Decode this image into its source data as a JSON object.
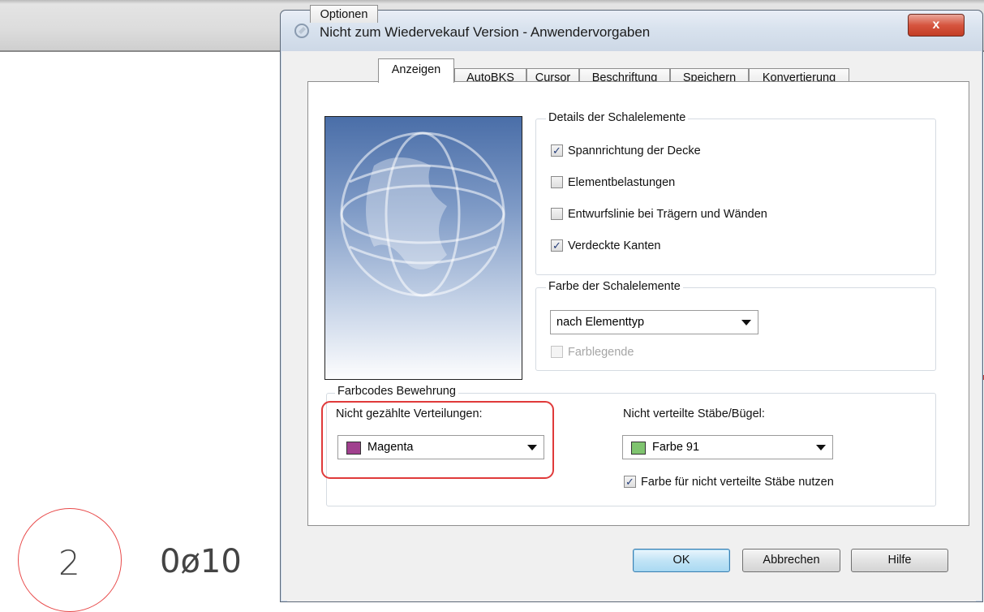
{
  "background": {
    "circle_number": "2",
    "label": "0ø10"
  },
  "dialog": {
    "title": "Nicht zum Wiedervekauf Version - Anwendervorgaben",
    "close_symbol": "x",
    "tabs": [
      {
        "label": "Optionen"
      },
      {
        "label": "Anzeigen",
        "active": true
      },
      {
        "label": "AutoBKS"
      },
      {
        "label": "Cursor"
      },
      {
        "label": "Beschriftung"
      },
      {
        "label": "Speichern"
      },
      {
        "label": "Konvertierung"
      }
    ],
    "details_group": {
      "title": "Details der Schalelemente",
      "items": [
        {
          "label": "Spannrichtung der Decke",
          "checked": true
        },
        {
          "label": "Elementbelastungen",
          "checked": false
        },
        {
          "label": "Entwurfslinie bei Trägern und Wänden",
          "checked": false
        },
        {
          "label": "Verdeckte Kanten",
          "checked": true
        }
      ]
    },
    "color_group": {
      "title": "Farbe der Schalelemente",
      "dropdown_value": "nach Elementtyp",
      "legend_label": "Farblegende",
      "legend_checked": false,
      "legend_enabled": false
    },
    "reinforcement_group": {
      "title": "Farbcodes Bewehrung",
      "left_label": "Nicht gezählte Verteilungen:",
      "left_value": "Magenta",
      "left_color": "#a0408e",
      "right_label": "Nicht verteilte Stäbe/Bügel:",
      "right_value": "Farbe 91",
      "right_color": "#7fc46f",
      "use_color_label": "Farbe für nicht verteilte Stäbe nutzen",
      "use_color_checked": true
    },
    "buttons": {
      "ok": "OK",
      "cancel": "Abbrechen",
      "help": "Hilfe"
    }
  }
}
